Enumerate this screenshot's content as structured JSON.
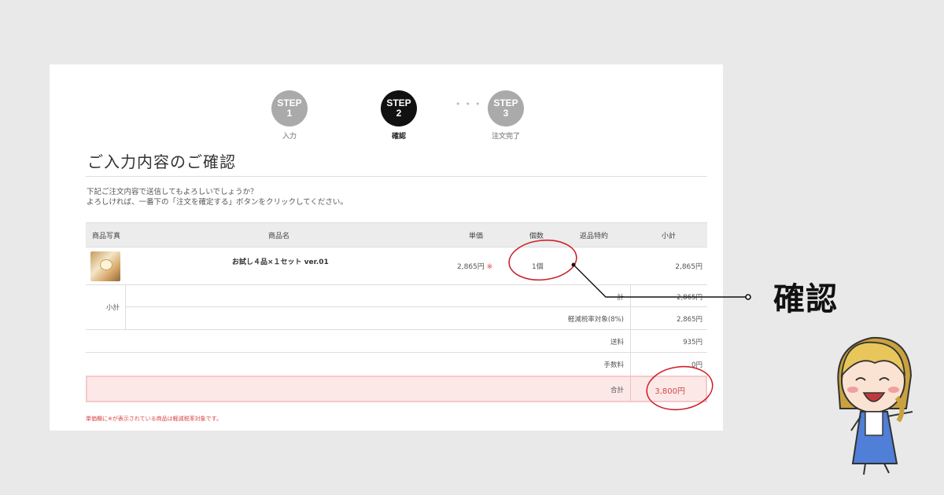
{
  "steps": [
    {
      "label": "STEP",
      "num": "1",
      "caption": "入力"
    },
    {
      "label": "STEP",
      "num": "2",
      "caption": "確認"
    },
    {
      "label": "STEP",
      "num": "3",
      "caption": "注文完了"
    }
  ],
  "page_title": "ご入力内容のご確認",
  "intro": {
    "line1": "下記ご注文内容で送信してもよろしいでしょうか？",
    "line2": "よろしければ、一番下の「注文を確定する」ボタンをクリックしてください。"
  },
  "table": {
    "headers": {
      "photo": "商品写真",
      "name": "商品名",
      "price": "単価",
      "qty": "個数",
      "bonus": "返品特約",
      "subtotal": "小計"
    },
    "item": {
      "name": "お試し４品×１セット ver.01",
      "price": "2,865円",
      "mark": "※",
      "qty": "1個",
      "subtotal": "2,865円"
    }
  },
  "summary": {
    "group_label": "小計",
    "rows": [
      {
        "label": "計",
        "value": "2,865円"
      },
      {
        "label": "軽減税率対象(8%)",
        "value": "2,865円"
      },
      {
        "label": "送料",
        "value": "935円"
      },
      {
        "label": "手数料",
        "value": "0円"
      }
    ],
    "total_label": "合計",
    "total_value": "3,800円"
  },
  "note": "単価欄に※が表示されている商品は軽減税率対象です。",
  "callout": "確認",
  "colors": {
    "active_step": "#111111",
    "inactive_step": "#aaaaaa",
    "annotation_red": "#d0202a",
    "total_bg": "#fde8e8"
  }
}
